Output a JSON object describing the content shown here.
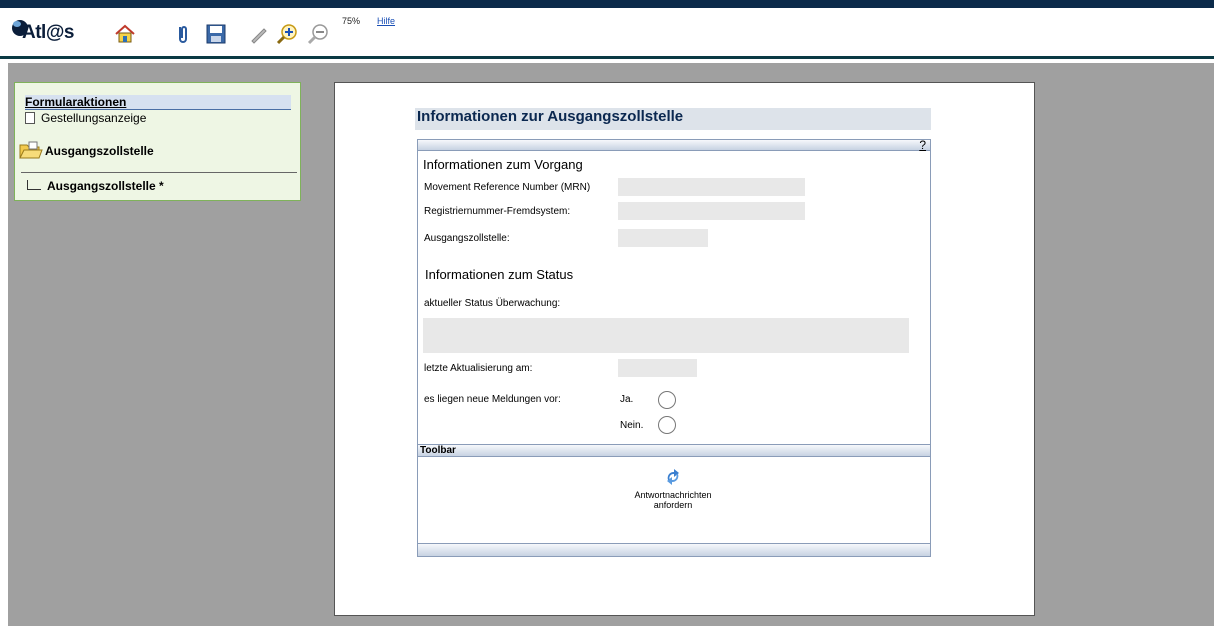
{
  "app": {
    "logo_text": "Atl@s"
  },
  "toolbar": {
    "icons": [
      "home-icon",
      "paperclip-icon",
      "save-icon",
      "pen-icon",
      "zoom-in-icon",
      "zoom-out-icon"
    ],
    "zoom_level": "75%",
    "help_label": "Hilfe"
  },
  "sidebar": {
    "title": "Formularaktionen",
    "item_gestellung": "Gestellungsanzeige",
    "folder_label": "Ausgangszollstelle",
    "sub_item": "Ausgangszollstelle *"
  },
  "form": {
    "title": "Informationen zur Ausgangszollstelle",
    "help_mark": "?",
    "section_vorgang": "Informationen zum Vorgang",
    "mrn_label": "Movement Reference Number (MRN)",
    "mrn_value": "",
    "regnr_label": "Registriernummer-Fremdsystem:",
    "regnr_value": "",
    "ausgang_label": "Ausgangszollstelle:",
    "ausgang_value": "",
    "section_status": "Informationen zum Status",
    "status_label": "aktueller Status Überwachung:",
    "status_value": "",
    "update_label": "letzte Aktualisierung am:",
    "update_value": "",
    "news_label": "es liegen neue Meldungen vor:",
    "radio_yes": "Ja.",
    "radio_no": "Nein.",
    "toolbar_label": "Toolbar",
    "action_line1": "Antwortnachrichten",
    "action_line2": "anfordern"
  },
  "colors": {
    "topbar": "#0b2a4a",
    "workspace": "#a0a0a0",
    "sidebar_bg": "#eef6e4",
    "sidebar_border": "#7fb25a",
    "title_text": "#0b2850",
    "help_link": "#1a4fb5"
  }
}
